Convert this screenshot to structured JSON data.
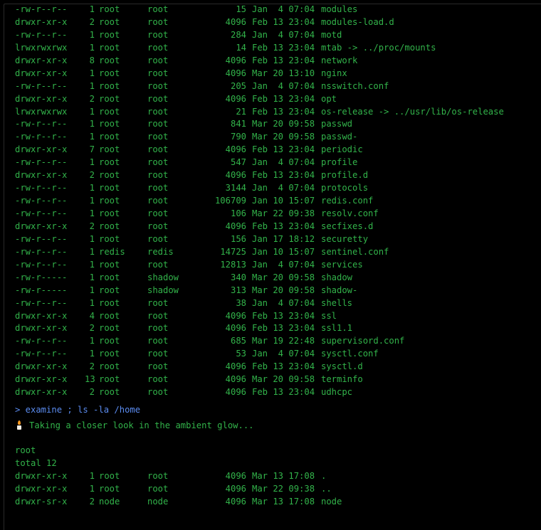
{
  "listing_etc": [
    {
      "perm": "-rw-r--r--",
      "links": "1",
      "owner": "root",
      "group": "root",
      "size": "15",
      "date": "Jan  4 07:04",
      "name": "modules"
    },
    {
      "perm": "drwxr-xr-x",
      "links": "2",
      "owner": "root",
      "group": "root",
      "size": "4096",
      "date": "Feb 13 23:04",
      "name": "modules-load.d"
    },
    {
      "perm": "-rw-r--r--",
      "links": "1",
      "owner": "root",
      "group": "root",
      "size": "284",
      "date": "Jan  4 07:04",
      "name": "motd"
    },
    {
      "perm": "lrwxrwxrwx",
      "links": "1",
      "owner": "root",
      "group": "root",
      "size": "14",
      "date": "Feb 13 23:04",
      "name": "mtab -> ../proc/mounts"
    },
    {
      "perm": "drwxr-xr-x",
      "links": "8",
      "owner": "root",
      "group": "root",
      "size": "4096",
      "date": "Feb 13 23:04",
      "name": "network"
    },
    {
      "perm": "drwxr-xr-x",
      "links": "1",
      "owner": "root",
      "group": "root",
      "size": "4096",
      "date": "Mar 20 13:10",
      "name": "nginx"
    },
    {
      "perm": "-rw-r--r--",
      "links": "1",
      "owner": "root",
      "group": "root",
      "size": "205",
      "date": "Jan  4 07:04",
      "name": "nsswitch.conf"
    },
    {
      "perm": "drwxr-xr-x",
      "links": "2",
      "owner": "root",
      "group": "root",
      "size": "4096",
      "date": "Feb 13 23:04",
      "name": "opt"
    },
    {
      "perm": "lrwxrwxrwx",
      "links": "1",
      "owner": "root",
      "group": "root",
      "size": "21",
      "date": "Feb 13 23:04",
      "name": "os-release -> ../usr/lib/os-release"
    },
    {
      "perm": "-rw-r--r--",
      "links": "1",
      "owner": "root",
      "group": "root",
      "size": "841",
      "date": "Mar 20 09:58",
      "name": "passwd"
    },
    {
      "perm": "-rw-r--r--",
      "links": "1",
      "owner": "root",
      "group": "root",
      "size": "790",
      "date": "Mar 20 09:58",
      "name": "passwd-"
    },
    {
      "perm": "drwxr-xr-x",
      "links": "7",
      "owner": "root",
      "group": "root",
      "size": "4096",
      "date": "Feb 13 23:04",
      "name": "periodic"
    },
    {
      "perm": "-rw-r--r--",
      "links": "1",
      "owner": "root",
      "group": "root",
      "size": "547",
      "date": "Jan  4 07:04",
      "name": "profile"
    },
    {
      "perm": "drwxr-xr-x",
      "links": "2",
      "owner": "root",
      "group": "root",
      "size": "4096",
      "date": "Feb 13 23:04",
      "name": "profile.d"
    },
    {
      "perm": "-rw-r--r--",
      "links": "1",
      "owner": "root",
      "group": "root",
      "size": "3144",
      "date": "Jan  4 07:04",
      "name": "protocols"
    },
    {
      "perm": "-rw-r--r--",
      "links": "1",
      "owner": "root",
      "group": "root",
      "size": "106709",
      "date": "Jan 10 15:07",
      "name": "redis.conf"
    },
    {
      "perm": "-rw-r--r--",
      "links": "1",
      "owner": "root",
      "group": "root",
      "size": "106",
      "date": "Mar 22 09:38",
      "name": "resolv.conf"
    },
    {
      "perm": "drwxr-xr-x",
      "links": "2",
      "owner": "root",
      "group": "root",
      "size": "4096",
      "date": "Feb 13 23:04",
      "name": "secfixes.d"
    },
    {
      "perm": "-rw-r--r--",
      "links": "1",
      "owner": "root",
      "group": "root",
      "size": "156",
      "date": "Jan 17 18:12",
      "name": "securetty"
    },
    {
      "perm": "-rw-r--r--",
      "links": "1",
      "owner": "redis",
      "group": "redis",
      "size": "14725",
      "date": "Jan 10 15:07",
      "name": "sentinel.conf"
    },
    {
      "perm": "-rw-r--r--",
      "links": "1",
      "owner": "root",
      "group": "root",
      "size": "12813",
      "date": "Jan  4 07:04",
      "name": "services"
    },
    {
      "perm": "-rw-r-----",
      "links": "1",
      "owner": "root",
      "group": "shadow",
      "size": "340",
      "date": "Mar 20 09:58",
      "name": "shadow"
    },
    {
      "perm": "-rw-r-----",
      "links": "1",
      "owner": "root",
      "group": "shadow",
      "size": "313",
      "date": "Mar 20 09:58",
      "name": "shadow-"
    },
    {
      "perm": "-rw-r--r--",
      "links": "1",
      "owner": "root",
      "group": "root",
      "size": "38",
      "date": "Jan  4 07:04",
      "name": "shells"
    },
    {
      "perm": "drwxr-xr-x",
      "links": "4",
      "owner": "root",
      "group": "root",
      "size": "4096",
      "date": "Feb 13 23:04",
      "name": "ssl"
    },
    {
      "perm": "drwxr-xr-x",
      "links": "2",
      "owner": "root",
      "group": "root",
      "size": "4096",
      "date": "Feb 13 23:04",
      "name": "ssl1.1"
    },
    {
      "perm": "-rw-r--r--",
      "links": "1",
      "owner": "root",
      "group": "root",
      "size": "685",
      "date": "Mar 19 22:48",
      "name": "supervisord.conf"
    },
    {
      "perm": "-rw-r--r--",
      "links": "1",
      "owner": "root",
      "group": "root",
      "size": "53",
      "date": "Jan  4 07:04",
      "name": "sysctl.conf"
    },
    {
      "perm": "drwxr-xr-x",
      "links": "2",
      "owner": "root",
      "group": "root",
      "size": "4096",
      "date": "Feb 13 23:04",
      "name": "sysctl.d"
    },
    {
      "perm": "drwxr-xr-x",
      "links": "13",
      "owner": "root",
      "group": "root",
      "size": "4096",
      "date": "Mar 20 09:58",
      "name": "terminfo"
    },
    {
      "perm": "drwxr-xr-x",
      "links": "2",
      "owner": "root",
      "group": "root",
      "size": "4096",
      "date": "Feb 13 23:04",
      "name": "udhcpc"
    }
  ],
  "command": "> examine ; ls -la /home",
  "message": {
    "icon": "candle-icon",
    "text": "Taking a closer look in the ambient glow..."
  },
  "output_user": "root",
  "output_total": "total 12",
  "listing_home": [
    {
      "perm": "drwxr-xr-x",
      "links": "1",
      "owner": "root",
      "group": "root",
      "size": "4096",
      "date": "Mar 13 17:08",
      "name": "."
    },
    {
      "perm": "drwxr-xr-x",
      "links": "1",
      "owner": "root",
      "group": "root",
      "size": "4096",
      "date": "Mar 22 09:38",
      "name": ".."
    },
    {
      "perm": "drwxr-sr-x",
      "links": "2",
      "owner": "node",
      "group": "node",
      "size": "4096",
      "date": "Mar 13 17:08",
      "name": "node"
    }
  ],
  "colors": {
    "background": "#000000",
    "output_text": "#32b34a",
    "command_text": "#5b8cf0"
  }
}
